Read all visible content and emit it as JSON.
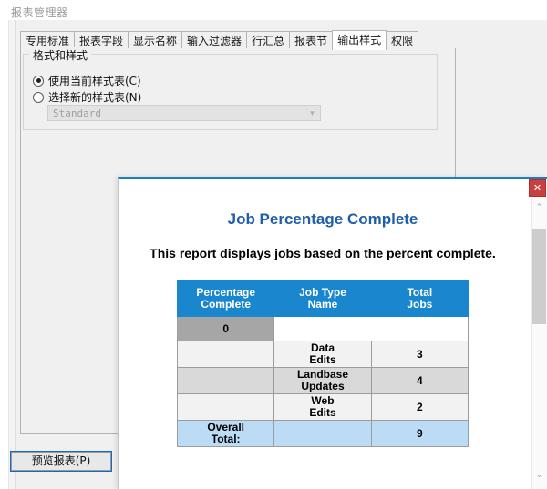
{
  "app": {
    "title": "报表管理器",
    "tabs": [
      {
        "label": "专用标准",
        "active": false
      },
      {
        "label": "报表字段",
        "active": false
      },
      {
        "label": "显示名称",
        "active": false
      },
      {
        "label": "输入过滤器",
        "active": false
      },
      {
        "label": "行汇总",
        "active": false
      },
      {
        "label": "报表节",
        "active": false
      },
      {
        "label": "输出样式",
        "active": true
      },
      {
        "label": "权限",
        "active": false
      }
    ],
    "group": {
      "legend": "格式和样式",
      "radio_current": "使用当前样式表(C)",
      "radio_new": "选择新的样式表(N)",
      "combo_value": "Standard",
      "combo_arrow": "▾"
    },
    "preview_button": "预览报表(P)"
  },
  "dialog": {
    "close_label": "✕",
    "title": "Job Percentage Complete",
    "subtitle": "This report displays jobs based on the percent complete.",
    "scroll_up": "⌃",
    "scroll_down": "⌄",
    "table": {
      "headers": [
        "Percentage\nComplete",
        "Job Type\nName",
        "Total\nJobs"
      ],
      "header_pct_line1": "Percentage",
      "header_pct_line2": "Complete",
      "header_name_line1": "Job Type",
      "header_name_line2": "Name",
      "header_total_line1": "Total",
      "header_total_line2": "Jobs",
      "rows": [
        {
          "style": "row-pct",
          "percentage": "0",
          "job_type": "",
          "total": ""
        },
        {
          "style": "row-light",
          "percentage": "",
          "job_type": "Data\nEdits",
          "job_type_l1": "Data",
          "job_type_l2": "Edits",
          "total": "3"
        },
        {
          "style": "row-dark",
          "percentage": "",
          "job_type": "Landbase\nUpdates",
          "job_type_l1": "Landbase",
          "job_type_l2": "Updates",
          "total": "4"
        },
        {
          "style": "row-light",
          "percentage": "",
          "job_type": "Web\nEdits",
          "job_type_l1": "Web",
          "job_type_l2": "Edits",
          "total": "2"
        },
        {
          "style": "row-total",
          "percentage": "Overall\nTotal:",
          "pct_l1": "Overall",
          "pct_l2": "Total:",
          "job_type": "",
          "total": "9"
        }
      ]
    }
  },
  "colors": {
    "header_blue": "#1a86cd",
    "title_blue": "#1f5fa8",
    "total_row": "#bcdcf5",
    "close_red": "#c9413f",
    "dialog_top_border": "#1a7fc1"
  }
}
